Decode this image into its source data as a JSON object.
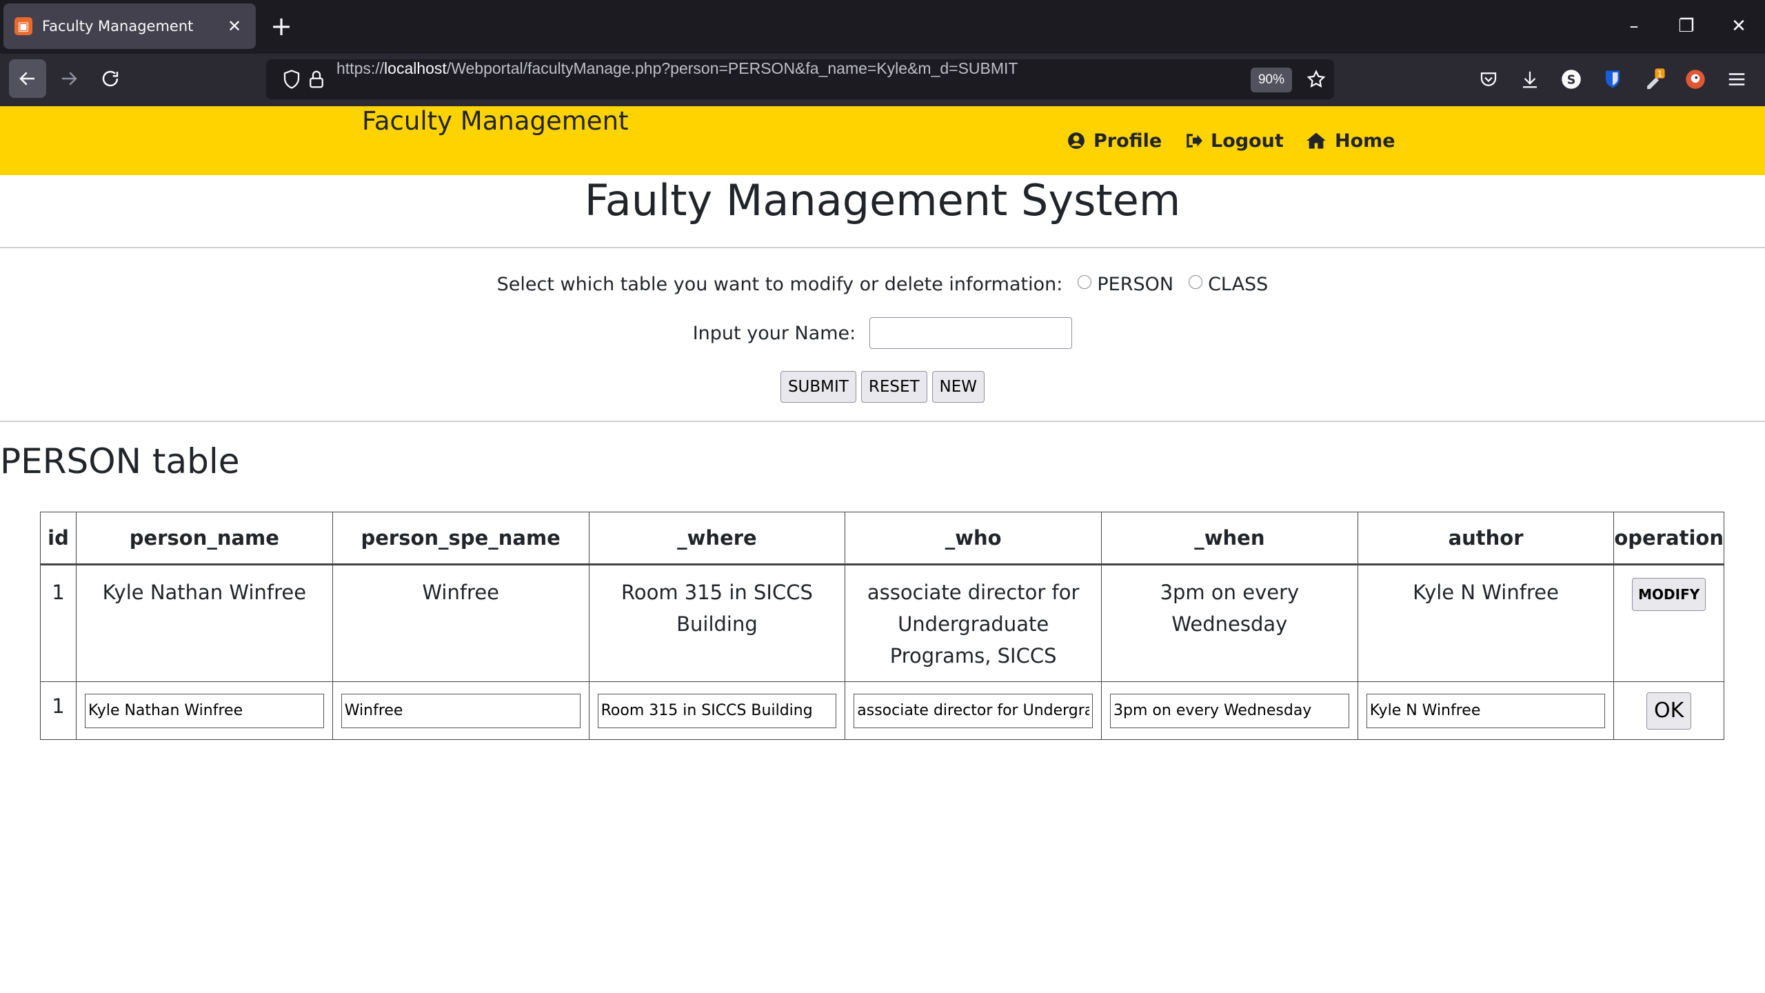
{
  "browser": {
    "tab_title": "Faculty Management",
    "tab_favicon": "phpstorm-icon",
    "url_prefix": "https://",
    "url_host": "localhost",
    "url_path": "/Webportal/facultyManage.php?person=PERSON&fa_name=Kyle&m_d=SUBMIT",
    "zoom": "90%",
    "extension_badge": "1"
  },
  "header": {
    "brand": "Faculty Management",
    "nav": [
      {
        "label": "Profile",
        "icon": "user-circle-icon"
      },
      {
        "label": "Logout",
        "icon": "sign-out-icon"
      },
      {
        "label": "Home",
        "icon": "home-icon"
      }
    ]
  },
  "page_title": "Faulty Management System",
  "form": {
    "select_label": "Select which table you want to modify or delete information:",
    "options": [
      "PERSON",
      "CLASS"
    ],
    "name_label": "Input your Name:",
    "name_value": "",
    "buttons": [
      "SUBMIT",
      "RESET",
      "NEW"
    ]
  },
  "table": {
    "heading": "PERSON table",
    "columns": [
      "id",
      "person_name",
      "person_spe_name",
      "_where",
      "_who",
      "_when",
      "author",
      "operation"
    ],
    "row": {
      "id": "1",
      "person_name": "Kyle Nathan Winfree",
      "person_spe_name": "Winfree",
      "where": "Room 315 in SICCS Building",
      "who": "associate director for Undergraduate Programs, SICCS",
      "when": "3pm on every Wednesday",
      "author": "Kyle N Winfree",
      "operation": "MODIFY"
    },
    "edit_row": {
      "id": "1",
      "person_name": "Kyle Nathan Winfree",
      "person_spe_name": "Winfree",
      "where": "Room 315 in SICCS Building",
      "who": "associate director for Undergraduate Programs, SICCS",
      "when": "3pm on every Wednesday",
      "author": "Kyle N Winfree",
      "operation": "OK"
    }
  },
  "colors": {
    "header_bg": "#ffd300",
    "browser_tabbar": "#1c1b22",
    "browser_toolbar": "#2b2a33"
  }
}
